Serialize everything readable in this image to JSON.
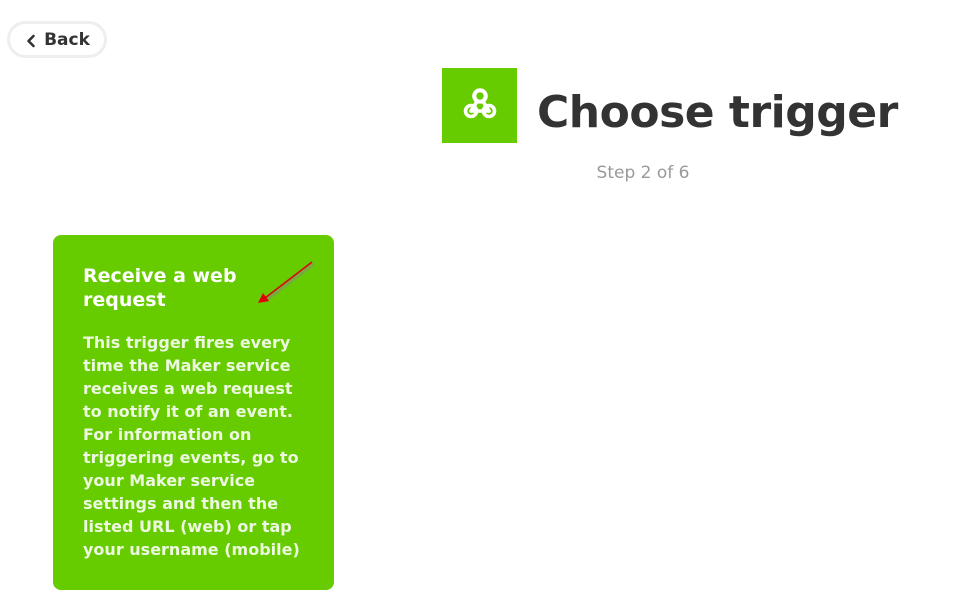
{
  "back_button": {
    "label": "Back",
    "icon": "chevron-left-icon"
  },
  "header": {
    "service_icon": "webhooks-icon",
    "service_color": "#66cc00",
    "title": "Choose trigger",
    "step": "Step 2 of 6"
  },
  "trigger_card": {
    "title": "Receive a web request",
    "description": "This trigger fires every time the Maker service receives a web request to notify it of an event. For information on triggering events, go to your Maker service settings and then the listed URL (web) or tap your username (mobile)",
    "background_color": "#66cc00"
  },
  "annotation": {
    "type": "arrow",
    "color": "#e00000"
  }
}
